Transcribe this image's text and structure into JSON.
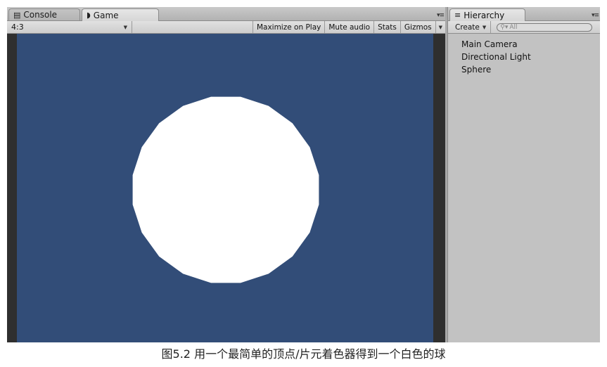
{
  "game_panel": {
    "tabs": [
      {
        "label": "Console",
        "icon": "console-icon",
        "active": false
      },
      {
        "label": "Game",
        "icon": "game-icon",
        "active": true
      }
    ],
    "toolbar": {
      "aspect": "4:3",
      "buttons": [
        "Maximize on Play",
        "Mute audio",
        "Stats",
        "Gizmos"
      ]
    },
    "colors": {
      "camera_background": "#324d78",
      "sphere": "#ffffff"
    }
  },
  "hierarchy_panel": {
    "tab_label": "Hierarchy",
    "create_label": "Create",
    "search_placeholder": "All",
    "items": [
      "Main Camera",
      "Directional Light",
      "Sphere"
    ]
  },
  "caption": "图5.2 用一个最简单的顶点/片元着色器得到一个白色的球"
}
